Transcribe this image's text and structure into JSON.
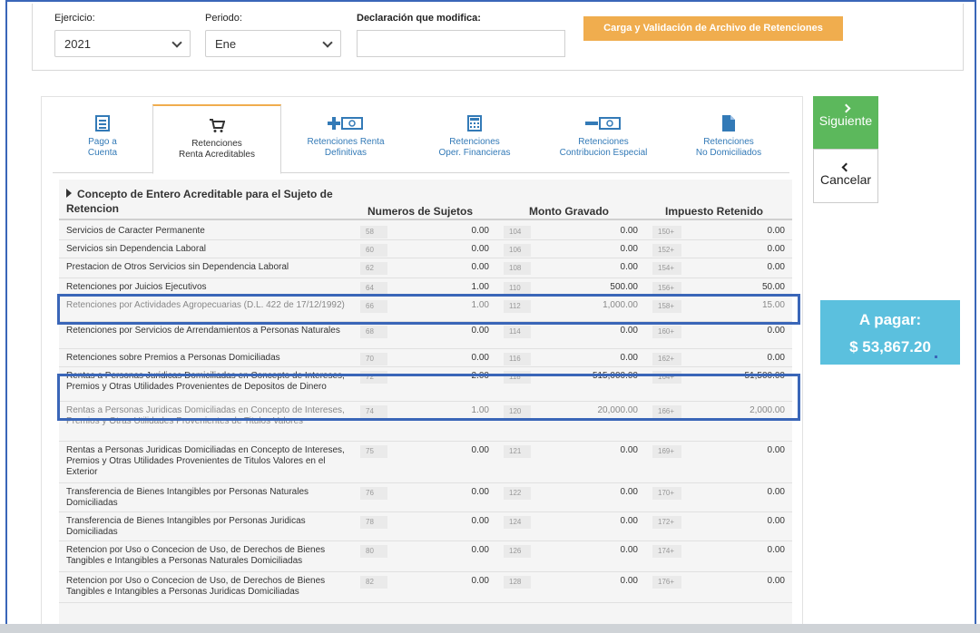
{
  "form": {
    "ejercicio_label": "Ejercicio:",
    "ejercicio_value": "2021",
    "periodo_label": "Periodo:",
    "periodo_value": "Ene",
    "declaracion_label": "Declaración que modifica:",
    "declaracion_value": "",
    "upload_button": "Carga y Validación de Archivo de Retenciones"
  },
  "tabs": [
    {
      "line1": "Pago a",
      "line2": "Cuenta",
      "icon": "receipt-icon"
    },
    {
      "line1": "Retenciones",
      "line2": "Renta Acreditables",
      "icon": "cart-icon"
    },
    {
      "line1": "Retenciones Renta",
      "line2": "Definitivas",
      "icon": "plus-money-icon"
    },
    {
      "line1": "Retenciones",
      "line2": "Oper. Financieras",
      "icon": "calculator-icon"
    },
    {
      "line1": "Retenciones",
      "line2": "Contribucion Especial",
      "icon": "minus-money-icon"
    },
    {
      "line1": "Retenciones",
      "line2": "No Domiciliados",
      "icon": "document-icon"
    }
  ],
  "active_tab": 1,
  "table": {
    "headers": {
      "concepto": "Concepto de Entero Acreditable para el Sujeto de Retencion",
      "sujetos": "Numeros de Sujetos",
      "gravado": "Monto Gravado",
      "retenido": "Impuesto Retenido"
    },
    "rows": [
      {
        "concepto": "Servicios de Caracter Permanente",
        "c1": "58",
        "sujetos": "0.00",
        "c2": "104",
        "gravado": "0.00",
        "c3": "150+",
        "retenido": "0.00"
      },
      {
        "concepto": "Servicios sin Dependencia Laboral",
        "c1": "60",
        "sujetos": "0.00",
        "c2": "106",
        "gravado": "0.00",
        "c3": "152+",
        "retenido": "0.00"
      },
      {
        "concepto": "Prestacion de Otros Servicios sin Dependencia Laboral",
        "c1": "62",
        "sujetos": "0.00",
        "c2": "108",
        "gravado": "0.00",
        "c3": "154+",
        "retenido": "0.00"
      },
      {
        "concepto": "Retenciones por Juicios Ejecutivos",
        "c1": "64",
        "sujetos": "1.00",
        "c2": "110",
        "gravado": "500.00",
        "c3": "156+",
        "retenido": "50.00"
      },
      {
        "concepto": "Retenciones por Actividades Agropecuarias (D.L. 422 de 17/12/1992)",
        "c1": "66",
        "sujetos": "1.00",
        "c2": "112",
        "gravado": "1,000.00",
        "c3": "158+",
        "retenido": "15.00"
      },
      {
        "concepto": "Retenciones por Servicios de Arrendamientos a Personas Naturales",
        "c1": "68",
        "sujetos": "0.00",
        "c2": "114",
        "gravado": "0.00",
        "c3": "160+",
        "retenido": "0.00"
      },
      {
        "concepto": "Retenciones sobre Premios a Personas Domiciliadas",
        "c1": "70",
        "sujetos": "0.00",
        "c2": "116",
        "gravado": "0.00",
        "c3": "162+",
        "retenido": "0.00"
      },
      {
        "concepto": "Rentas a Personas Juridicas Domiciliadas en Concepto de Intereses, Premios y Otras Utilidades Provenientes de Depositos de Dinero",
        "c1": "72",
        "sujetos": "2.00",
        "c2": "118",
        "gravado": "515,000.00",
        "c3": "164+",
        "retenido": "51,500.00"
      },
      {
        "concepto": "Rentas a Personas Juridicas Domiciliadas en Concepto de Intereses, Premios y Otras Utilidades Provenientes de Titulos Valores",
        "c1": "74",
        "sujetos": "1.00",
        "c2": "120",
        "gravado": "20,000.00",
        "c3": "166+",
        "retenido": "2,000.00"
      },
      {
        "concepto": "Rentas a Personas Juridicas Domiciliadas en Concepto de Intereses, Premios y Otras Utilidades Provenientes de Titulos Valores en el Exterior",
        "c1": "75",
        "sujetos": "0.00",
        "c2": "121",
        "gravado": "0.00",
        "c3": "169+",
        "retenido": "0.00"
      },
      {
        "concepto": "Transferencia de Bienes Intangibles por Personas Naturales Domiciliadas",
        "c1": "76",
        "sujetos": "0.00",
        "c2": "122",
        "gravado": "0.00",
        "c3": "170+",
        "retenido": "0.00"
      },
      {
        "concepto": "Transferencia de Bienes Intangibles por Personas Juridicas Domiciliadas",
        "c1": "78",
        "sujetos": "0.00",
        "c2": "124",
        "gravado": "0.00",
        "c3": "172+",
        "retenido": "0.00"
      },
      {
        "concepto": "Retencion por Uso o Concecion de Uso, de Derechos de Bienes Tangibles e Intangibles a Personas Naturales Domiciliadas",
        "c1": "80",
        "sujetos": "0.00",
        "c2": "126",
        "gravado": "0.00",
        "c3": "174+",
        "retenido": "0.00"
      },
      {
        "concepto": "Retencion por Uso o Concecion de Uso, de Derechos de Bienes Tangibles e Intangibles a Personas Juridicas Domiciliadas",
        "c1": "82",
        "sujetos": "0.00",
        "c2": "128",
        "gravado": "0.00",
        "c3": "176+",
        "retenido": "0.00"
      }
    ]
  },
  "actions": {
    "next": "Siguiente",
    "cancel": "Cancelar"
  },
  "summary": {
    "label": "A pagar:",
    "amount": "$ 53,867.20"
  }
}
